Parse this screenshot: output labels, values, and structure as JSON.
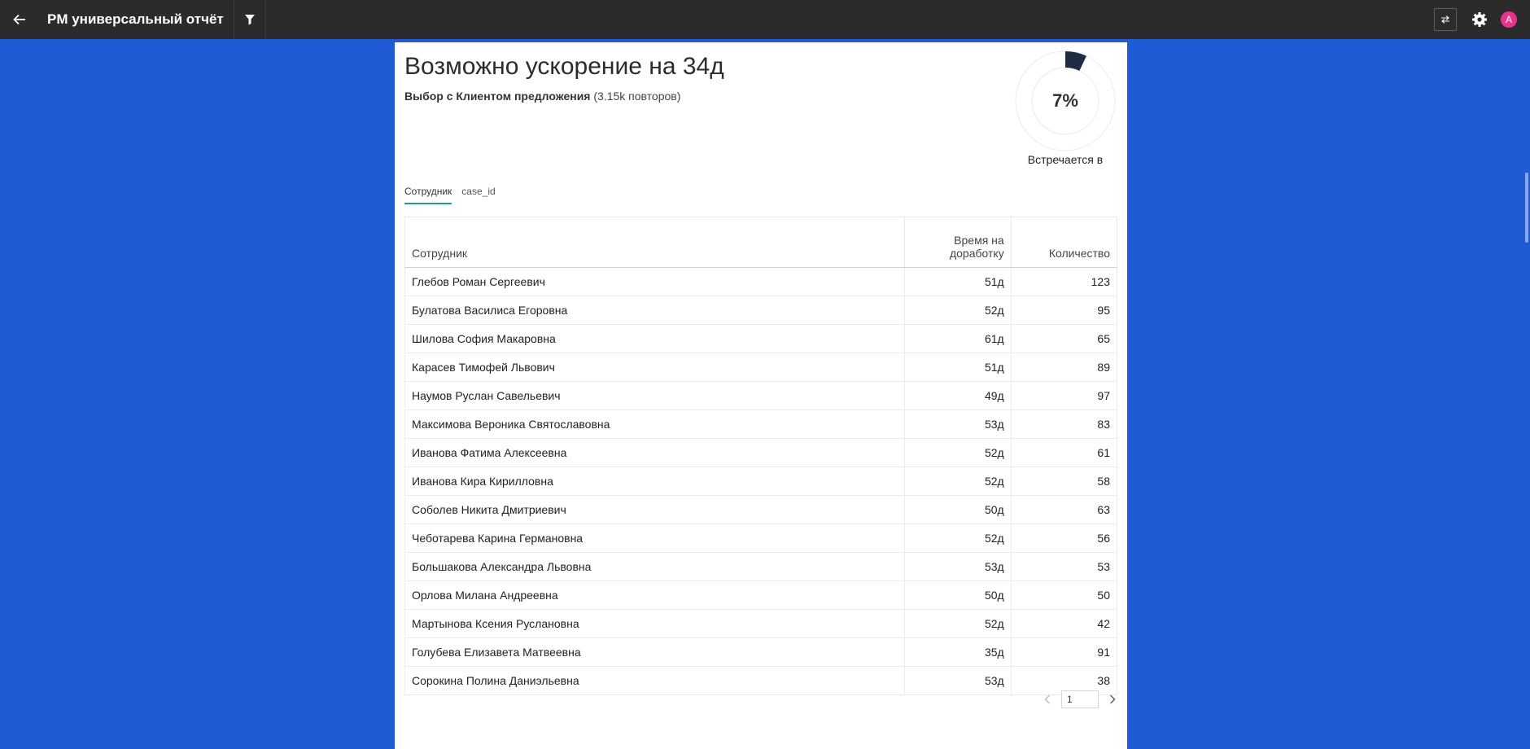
{
  "app": {
    "title": "PM универсальный отчёт",
    "avatar_letter": "A",
    "icons": [
      "back-arrow-icon",
      "filter-icon",
      "toggle-icon",
      "gear-icon"
    ]
  },
  "header": {
    "title": "Возможно ускорение на 34д",
    "subtitle_bold": "Выбор с Клиентом предложения",
    "subtitle_rest": " (3.15k повторов)"
  },
  "gauge": {
    "value_text": "7%",
    "fraction": 0.07,
    "caption": "Встречается в",
    "color": "#1f2d44"
  },
  "tabs": [
    {
      "label": "Сотрудник",
      "active": true
    },
    {
      "label": "case_id",
      "active": false
    }
  ],
  "table": {
    "headers": [
      "Сотрудник",
      "Время на доработку",
      "Количество"
    ],
    "rows": [
      [
        "Глебов Роман Сергеевич",
        "51д",
        "123"
      ],
      [
        "Булатова Василиса Егоровна",
        "52д",
        "95"
      ],
      [
        "Шилова София Макаровна",
        "61д",
        "65"
      ],
      [
        "Карасев Тимофей Львович",
        "51д",
        "89"
      ],
      [
        "Наумов Руслан Савельевич",
        "49д",
        "97"
      ],
      [
        "Максимова Вероника Святославовна",
        "53д",
        "83"
      ],
      [
        "Иванова Фатима Алексеевна",
        "52д",
        "61"
      ],
      [
        "Иванова Кира Кирилловна",
        "52д",
        "58"
      ],
      [
        "Соболев Никита Дмитриевич",
        "50д",
        "63"
      ],
      [
        "Чеботарева Карина Германовна",
        "52д",
        "56"
      ],
      [
        "Большакова Александра Львовна",
        "53д",
        "53"
      ],
      [
        "Орлова Милана Андреевна",
        "50д",
        "50"
      ],
      [
        "Мартынова Ксения Руслановна",
        "52д",
        "42"
      ],
      [
        "Голубева Елизавета Матвеевна",
        "35д",
        "91"
      ],
      [
        "Сорокина Полина Даниэльевна",
        "53д",
        "38"
      ]
    ]
  },
  "pagination": {
    "page_value": "1"
  },
  "colors": {
    "background": "#1e5bd4",
    "topbar": "#2b2b2b",
    "tab_accent": "#1a9e9e",
    "avatar": "#e8338a"
  }
}
